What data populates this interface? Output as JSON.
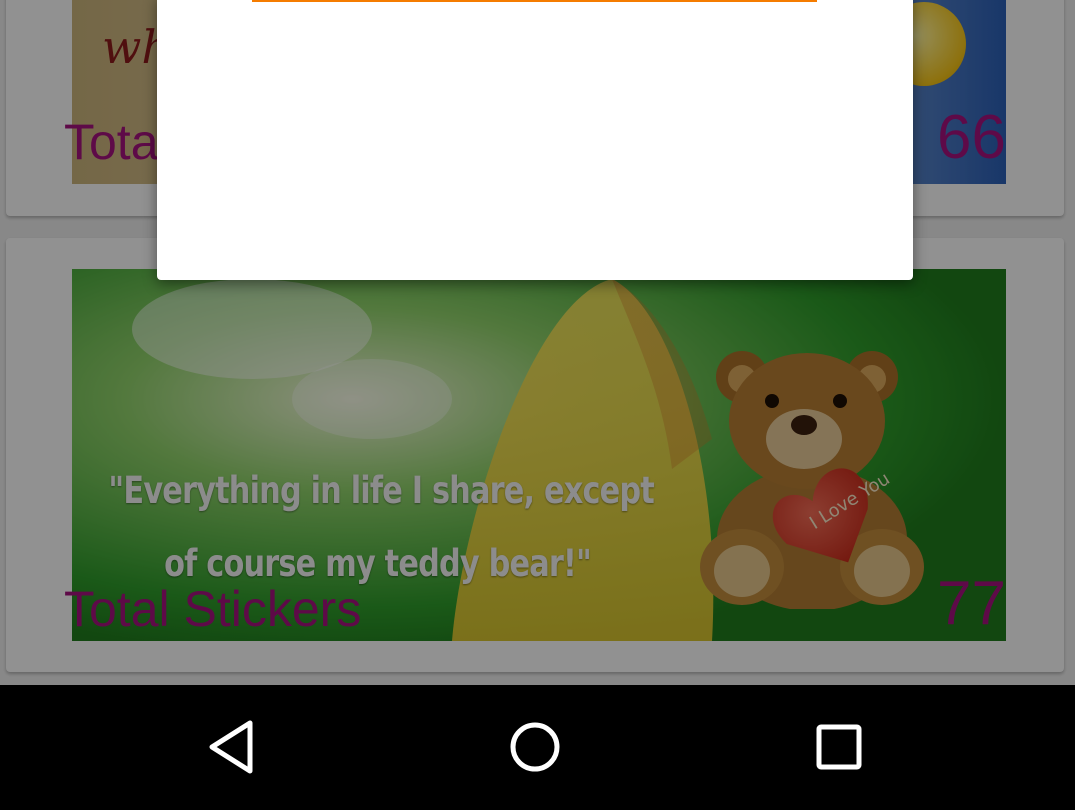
{
  "cards": [
    {
      "banner_text": "wh",
      "label": "Total",
      "count": "66"
    },
    {
      "quote_line1": "\"Everything in life I share, except",
      "quote_line2": "of course my teddy bear!\"",
      "heart_text": "I Love You",
      "label": "Total Stickers",
      "count": "77"
    }
  ],
  "dialog": {
    "progress_color": "#f57c00"
  },
  "navbar": {
    "back_icon": "back-triangle",
    "home_icon": "home-circle",
    "recent_icon": "recents-square"
  },
  "colors": {
    "accent_text": "#a3127c",
    "dim_overlay": "rgba(0,0,0,0.42)"
  }
}
